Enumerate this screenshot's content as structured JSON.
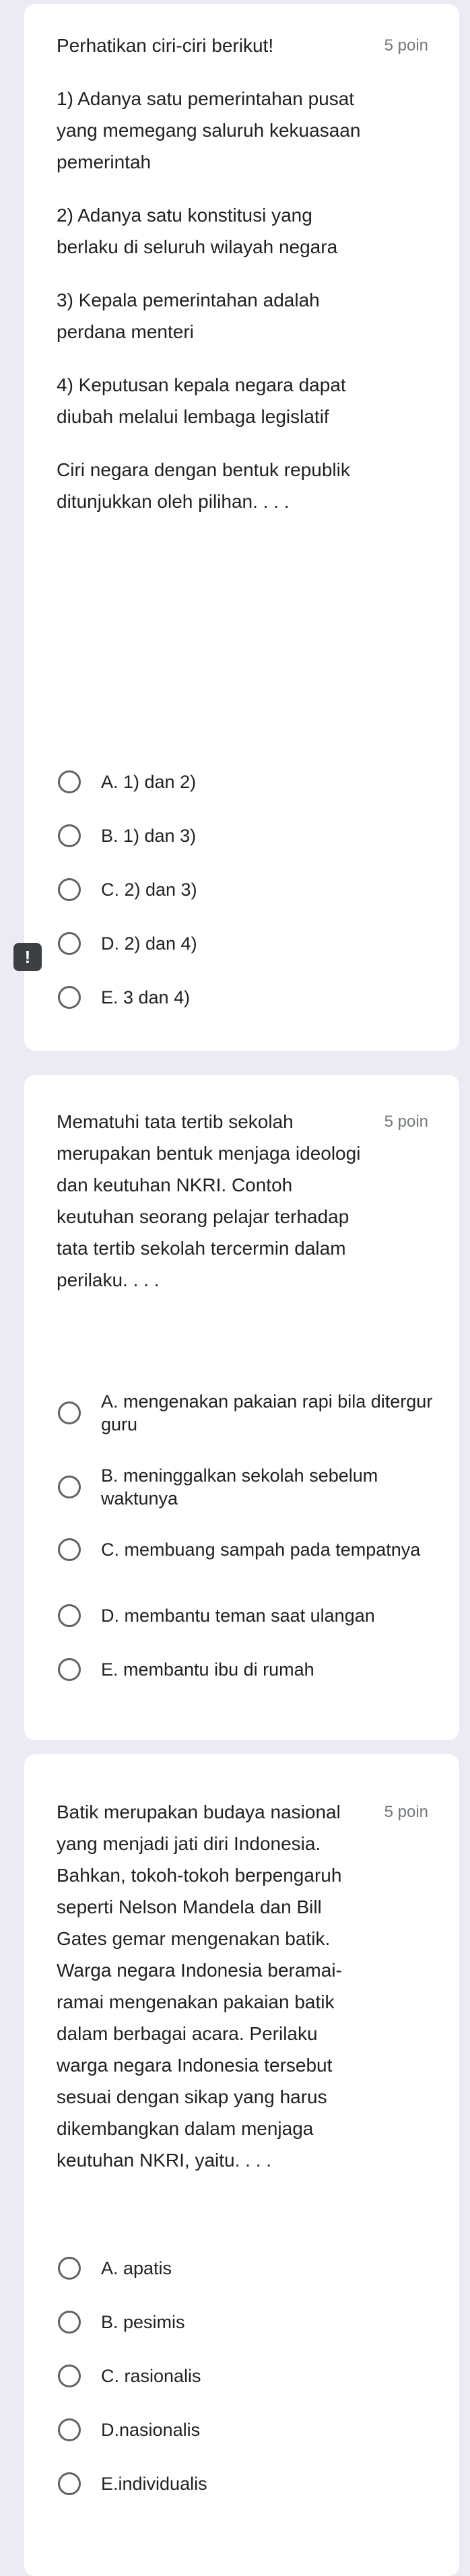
{
  "questions": [
    {
      "points": "5 poin",
      "paragraphs": [
        "Perhatikan ciri-ciri berikut!",
        "1) Adanya satu pemerintahan pusat yang memegang saluruh kekuasaan pemerintah",
        "2) Adanya satu konstitusi yang berlaku di seluruh wilayah negara",
        "3) Kepala pemerintahan adalah perdana menteri",
        "4) Keputusan kepala negara dapat diubah melalui lembaga legislatif",
        "Ciri negara dengan bentuk republik ditunjukkan oleh pilihan. . . ."
      ],
      "options": [
        "A. 1) dan 2)",
        "B. 1) dan 3)",
        "C. 2) dan 3)",
        "D. 2) dan 4)",
        "E. 3 dan 4)"
      ],
      "error_flag": "!"
    },
    {
      "points": "5 poin",
      "paragraphs": [
        "Mematuhi tata tertib sekolah merupakan bentuk menjaga ideologi dan keutuhan NKRI. Contoh keutuhan seorang pelajar terhadap tata tertib sekolah tercermin dalam perilaku. . . ."
      ],
      "options": [
        "A. mengenakan pakaian rapi bila ditergur guru",
        "B. meninggalkan sekolah sebelum waktunya",
        "C. membuang sampah pada tempatnya",
        "D. membantu teman saat ulangan",
        "E. membantu ibu di rumah"
      ]
    },
    {
      "points": "5 poin",
      "paragraphs": [
        "Batik merupakan budaya nasional yang menjadi jati diri Indonesia. Bahkan, tokoh-tokoh berpengaruh seperti Nelson Mandela dan Bill Gates gemar mengenakan batik. Warga negara Indonesia beramai-ramai mengenakan pakaian batik dalam berbagai acara. Perilaku warga negara Indonesia tersebut sesuai dengan sikap yang harus dikembangkan dalam menjaga keutuhan NKRI, yaitu. . . ."
      ],
      "options": [
        "A. apatis",
        "B. pesimis",
        "C. rasionalis",
        "D.nasionalis",
        "E.individualis"
      ]
    }
  ]
}
